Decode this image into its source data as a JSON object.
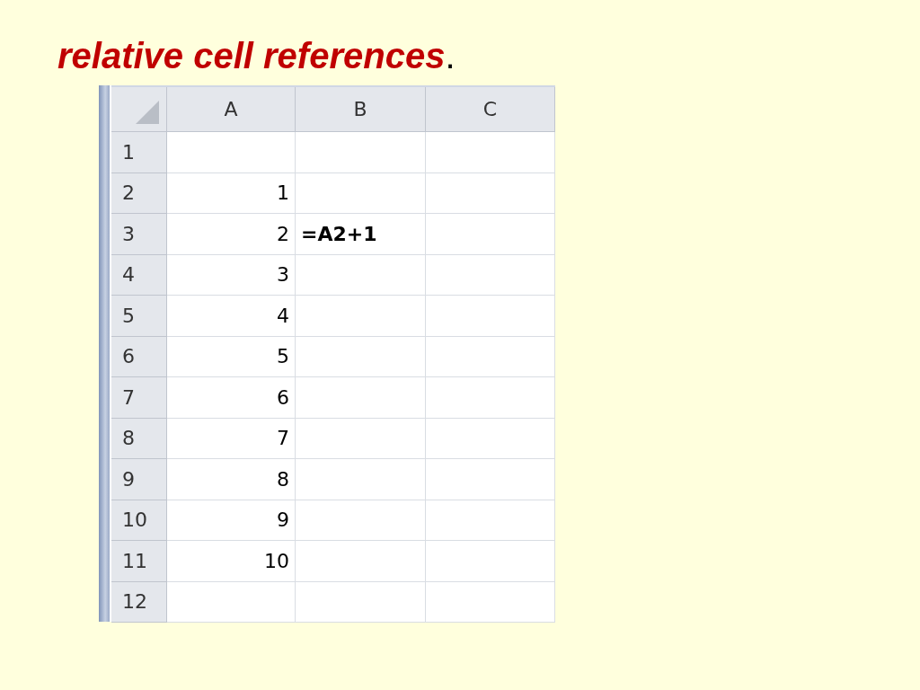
{
  "title": {
    "text": "relative cell references",
    "punctuation": "."
  },
  "sheet": {
    "columns": [
      "A",
      "B",
      "C"
    ],
    "rows": [
      {
        "header": "1"
      },
      {
        "header": "2",
        "a": "1"
      },
      {
        "header": "3",
        "a": "2",
        "b": "=A2+1"
      },
      {
        "header": "4",
        "a": "3"
      },
      {
        "header": "5",
        "a": "4"
      },
      {
        "header": "6",
        "a": "5"
      },
      {
        "header": "7",
        "a": "6"
      },
      {
        "header": "8",
        "a": "7"
      },
      {
        "header": "9",
        "a": "8"
      },
      {
        "header": "10",
        "a": "9"
      },
      {
        "header": "11",
        "a": "10"
      },
      {
        "header": "12"
      }
    ]
  }
}
